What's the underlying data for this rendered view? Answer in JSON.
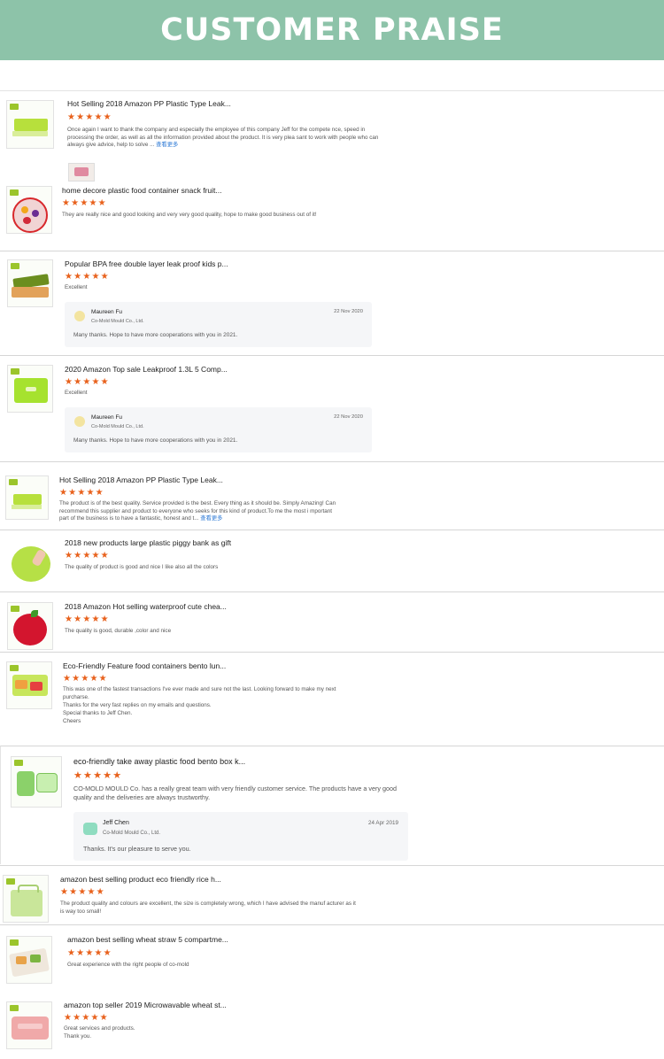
{
  "banner": {
    "title": "CUSTOMER PRAISE"
  },
  "stars": "★★★★★",
  "more_label": "查看更多",
  "reviews": [
    {
      "title": "Hot Selling 2018 Amazon PP Plastic Type Leak...",
      "text": "Once again I want to thank the company and especially the employee of this company Jeff for the compete nce, speed in processing the order, as well as all the information provided about the product. It is very plea sant to work with people who can always give advice, help to solve ..."
    },
    {
      "title": "home decore plastic food container snack fruit...",
      "text": "They are really nice and good looking and very very good quality, hope to make good business out of it!"
    },
    {
      "title": "Popular BPA free double layer leak proof kids p...",
      "text": "Excellent",
      "reply": {
        "name": "Maureen Fu",
        "company": "Co-Mold Mould Co., Ltd.",
        "date": "22 Nov 2020",
        "message": "Many thanks. Hope to have more cooperations with you in 2021."
      }
    },
    {
      "title": "2020 Amazon Top sale Leakproof 1.3L 5 Comp...",
      "text": "Excellent",
      "reply": {
        "name": "Maureen Fu",
        "company": "Co-Mold Mould Co., Ltd.",
        "date": "22 Nov 2020",
        "message": "Many thanks. Hope to have more cooperations with you in 2021."
      }
    },
    {
      "title": "Hot Selling 2018 Amazon PP Plastic Type Leak...",
      "text": "The product is of the best quality. Service provided is the best. Every thing as it should be. Simply Amazing! Can recommend this supplier and product to everyone who seeks for this kind of product.To me the most i mportant part of the business is to have a fantastic, honest and t..."
    },
    {
      "title": "2018 new products large plastic piggy bank as gift",
      "text": "The quality of product is good and nice   I like also all the colors"
    },
    {
      "title": "2018 Amazon Hot selling waterproof cute chea...",
      "text": "The quality is good, durable ,color and nice"
    },
    {
      "title": "Eco-Friendly Feature food containers bento lun...",
      "text": "This was one of the fastest transactions I've ever made and sure not the last. Looking forward to make my next purcharse.",
      "text2": "Thanks for the very fast replies on my emails and questions.",
      "text3": "Special thanks to Jeff Chen.",
      "text4": "Cheers"
    },
    {
      "title": "eco-friendly take away plastic food bento box k...",
      "text": "CO-MOLD MOULD Co. has a really great team with very friendly customer service. The products have a very good quality and the deliveries are always trustworthy.",
      "reply": {
        "name": "Jeff Chen",
        "company": "Co-Mold Mould Co., Ltd.",
        "date": "24 Apr 2019",
        "message": "Thanks. It's our pleasure to serve you."
      }
    },
    {
      "title": "amazon best selling product eco friendly rice h...",
      "text": "The product quality and colours are excellent, the size is completely wrong, which I have advised the manuf acturer as it is way too small!"
    },
    {
      "title": "amazon best selling wheat straw 5 compartme...",
      "text": "Great experience with the right people of co-mold"
    },
    {
      "title": "amazon top seller 2019 Microwavable wheat st...",
      "text": "Great services and products.",
      "text2": "Thank you."
    }
  ]
}
